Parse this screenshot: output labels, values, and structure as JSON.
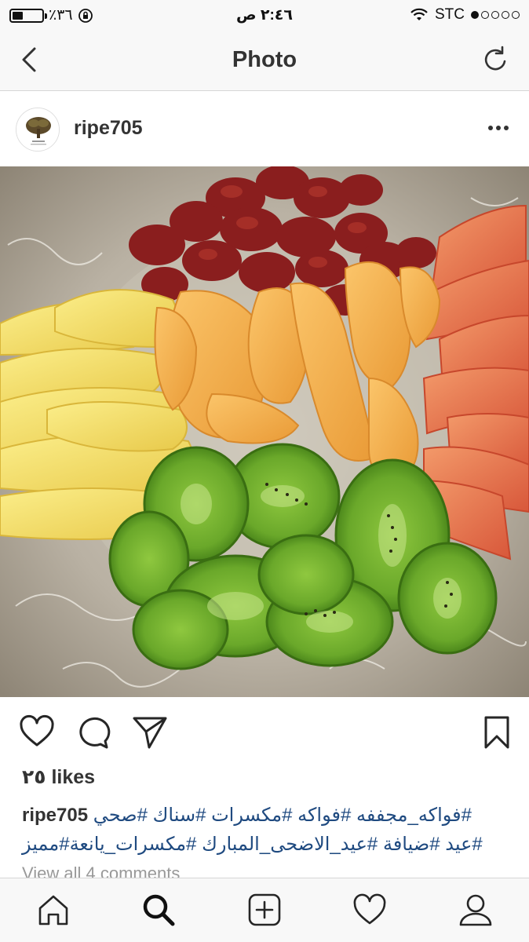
{
  "status_bar": {
    "battery_text": "٪٣٦",
    "battery_level": 0.36,
    "time": "٢:٤٦ ص",
    "carrier": "STC",
    "signal_bars": 1,
    "icons": [
      "battery-icon",
      "orientation-lock-icon",
      "wifi-icon",
      "signal-icon"
    ]
  },
  "nav": {
    "title": "Photo",
    "back_icon": "chevron-left-icon",
    "refresh_icon": "refresh-icon"
  },
  "post": {
    "username": "ripe705",
    "more_icon": "more-horizontal-icon",
    "photo_alt": "dried fruit platter",
    "actions": [
      "heart-icon",
      "comment-icon",
      "share-icon",
      "bookmark-icon"
    ],
    "likes": "٢٥ likes",
    "caption_user": "ripe705",
    "caption_line1": "#فواكه_مجففه #فواكه #مكسرات #سناك #صحي",
    "caption_line2": "#عيد #ضيافة #عيد_الاضحى_المبارك #مكسرات_يانعة#مميز",
    "view_comments": "View all 4 comments"
  },
  "tab_bar": {
    "items": [
      "home-icon",
      "search-icon",
      "add-icon",
      "activity-icon",
      "profile-icon"
    ],
    "active": "search-icon"
  },
  "colors": {
    "accent_link": "#1f4a80",
    "bar_bg": "#f8f8f8",
    "text": "#262626"
  }
}
